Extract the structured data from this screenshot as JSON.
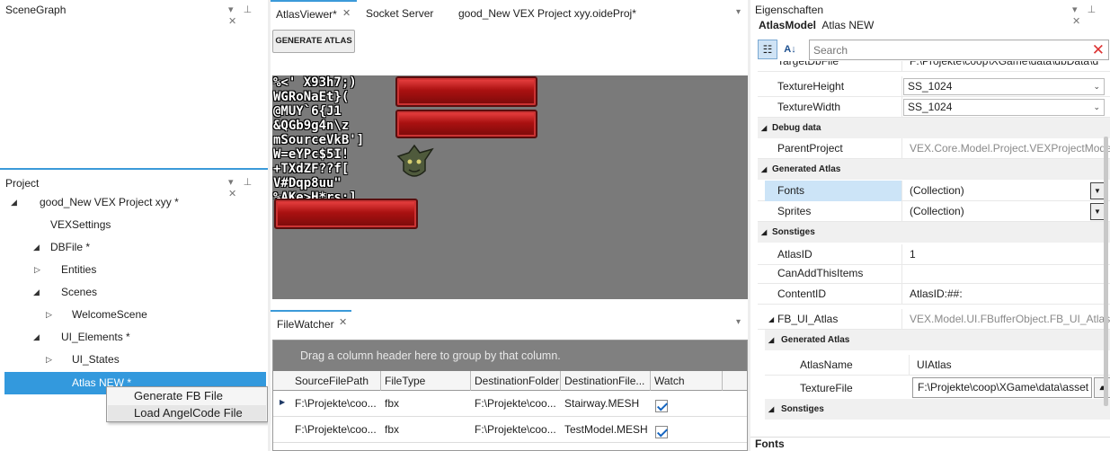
{
  "scenegraph": {
    "title": "SceneGraph"
  },
  "project": {
    "title": "Project",
    "items": [
      {
        "label": "good_New VEX Project xyy *",
        "expander": "◢",
        "level": 0
      },
      {
        "label": "VEXSettings",
        "expander": "",
        "level": 1
      },
      {
        "label": "DBFile *",
        "expander": "◢",
        "level": 1
      },
      {
        "label": "Entities",
        "expander": "▷",
        "level": 2
      },
      {
        "label": "Scenes",
        "expander": "◢",
        "level": 2
      },
      {
        "label": "WelcomeScene",
        "expander": "▷",
        "level": 3
      },
      {
        "label": "UI_Elements *",
        "expander": "◢",
        "level": 2
      },
      {
        "label": "UI_States",
        "expander": "▷",
        "level": 3
      },
      {
        "label": "Atlas NEW *",
        "expander": "",
        "level": 3
      }
    ]
  },
  "context_menu": {
    "items": [
      "Generate FB File",
      "Load AngelCode File"
    ]
  },
  "tabs": [
    {
      "label": "AtlasViewer*",
      "close": "✕"
    },
    {
      "label": "Socket Server",
      "close": ""
    },
    {
      "label": "good_New VEX Project xyy.oideProj*",
      "close": ""
    }
  ],
  "atlas_viewer": {
    "generate_button": "GENERATE ATLAS",
    "glyph_text": "%<' X93h7;)\nWGRoNaEt}(\n@MUY`6{J1\n&QGb9g4n\\z\nmSourceVkB']\nW=eYPc$5I!\n+TXdZF??f[\nV#Dqp8uu\"\n%AKe>H*rs;]"
  },
  "filewatcher": {
    "title": "FileWatcher",
    "group_hint": "Drag a column header here to group by that column.",
    "columns": [
      "SourceFilePath",
      "FileType",
      "DestinationFolder",
      "DestinationFile...",
      "Watch"
    ],
    "rows": [
      {
        "source": "F:\\Projekte\\coo...",
        "type": "fbx",
        "folder": "F:\\Projekte\\coo...",
        "file": "Stairway.MESH",
        "watch": true
      },
      {
        "source": "F:\\Projekte\\coo...",
        "type": "fbx",
        "folder": "F:\\Projekte\\coo...",
        "file": "TestModel.MESH",
        "watch": true
      }
    ]
  },
  "properties": {
    "title": "Eigenschaften",
    "object_type": "AtlasModel",
    "object_name": "Atlas NEW",
    "search_placeholder": "Search",
    "clipped_row": {
      "name": "TargetDbFile",
      "value": "F:\\Projekte\\coop\\XGame\\data\\dbData\\d"
    },
    "rows_top": [
      {
        "name": "TextureHeight",
        "value": "SS_1024"
      },
      {
        "name": "TextureWidth",
        "value": "SS_1024"
      }
    ],
    "cat_debug": "Debug data",
    "parent_project": {
      "name": "ParentProject",
      "value": "VEX.Core.Model.Project.VEXProjectModel"
    },
    "cat_generated": "Generated Atlas",
    "fonts": {
      "name": "Fonts",
      "value": "(Collection)"
    },
    "sprites": {
      "name": "Sprites",
      "value": "(Collection)"
    },
    "cat_misc": "Sonstiges",
    "atlas_id": {
      "name": "AtlasID",
      "value": "1"
    },
    "can_add": {
      "name": "CanAddThisItems",
      "value": ""
    },
    "content_id": {
      "name": "ContentID",
      "value": "AtlasID:##:"
    },
    "fb_ui_atlas": {
      "name": "FB_UI_Atlas",
      "value": "VEX.Model.UI.FBufferObject.FB_UI_Atlas"
    },
    "sub_cat_generated": "Generated Atlas",
    "atlas_name": {
      "name": "AtlasName",
      "value": "UIAtlas"
    },
    "texture_file": {
      "name": "TextureFile",
      "value": "F:\\Projekte\\coop\\XGame\\data\\asset"
    },
    "sub_cat_misc": "Sonstiges",
    "description_title": "Fonts"
  },
  "colors": {
    "selection": "#3399dd",
    "accent_top": "#3b9ad9",
    "highlight_row": "#cce4f7"
  }
}
